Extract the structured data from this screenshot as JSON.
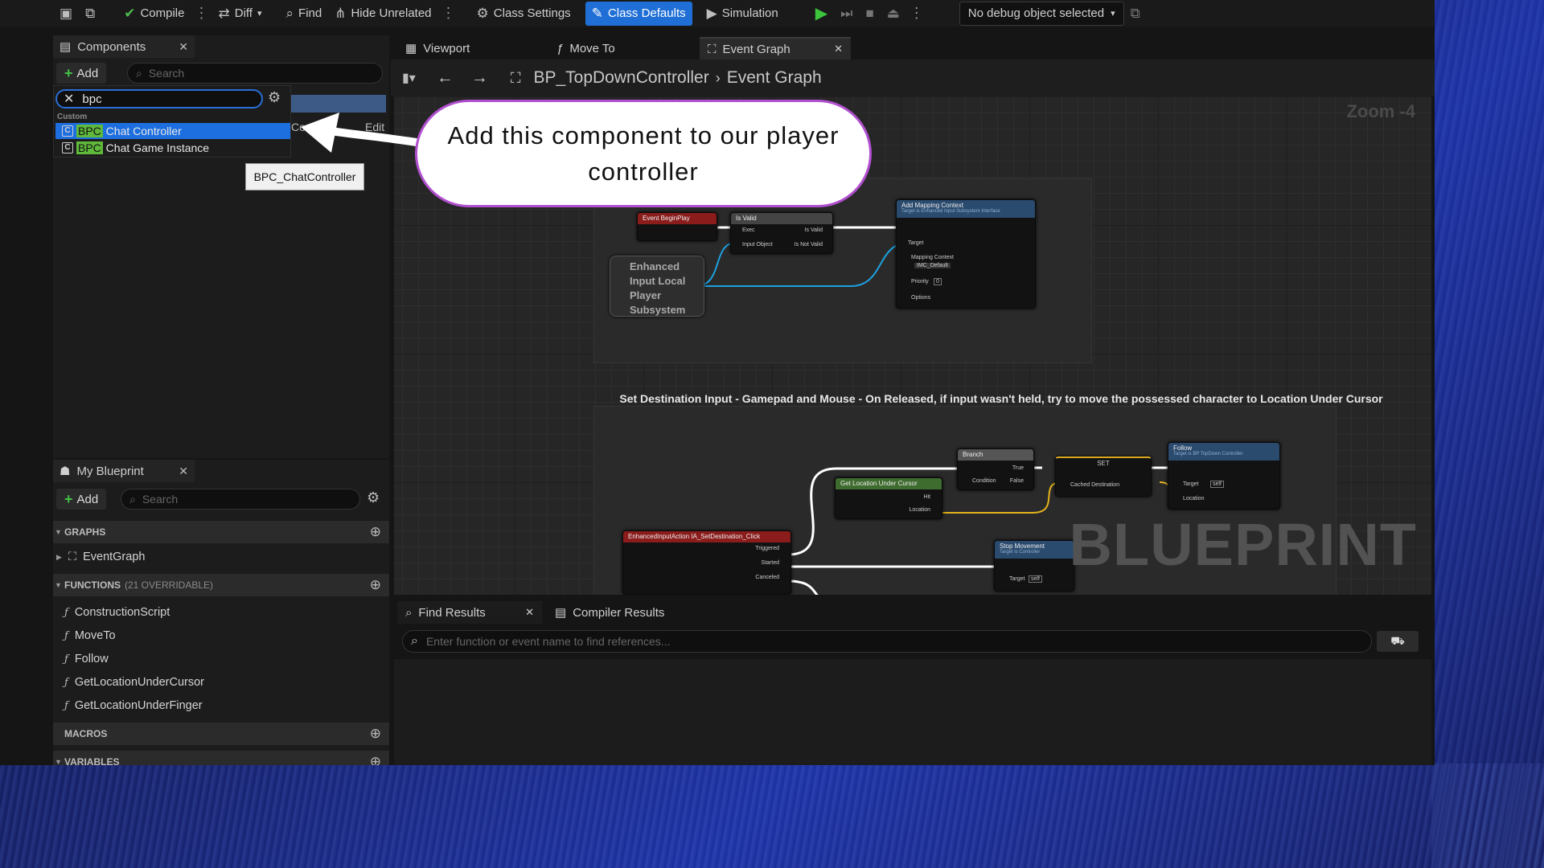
{
  "toolbar": {
    "compile": "Compile",
    "diff": "Diff",
    "find": "Find",
    "hide_unrelated": "Hide Unrelated",
    "class_settings": "Class Settings",
    "class_defaults": "Class Defaults",
    "simulation": "Simulation",
    "debug_object": "No debug object selected"
  },
  "components": {
    "tab_title": "Components",
    "add_label": "Add",
    "search_placeholder": "Search",
    "dropdown": {
      "query": "bpc",
      "category": "Custom",
      "items": [
        {
          "highlight": "BPC",
          "rest": " Chat Controller"
        },
        {
          "highlight": "BPC",
          "rest": " Chat Game Instance"
        }
      ],
      "partial_behind": "Co",
      "edit_label": "Edit"
    },
    "tooltip": "BPC_ChatController"
  },
  "my_blueprint": {
    "tab_title": "My Blueprint",
    "add_label": "Add",
    "search_placeholder": "Search",
    "sections": {
      "graphs": "GRAPHS",
      "functions": "FUNCTIONS",
      "functions_count": "(21 OVERRIDABLE)",
      "macros": "MACROS",
      "variables": "VARIABLES"
    },
    "graphs": [
      "EventGraph"
    ],
    "functions": [
      "ConstructionScript",
      "MoveTo",
      "Follow",
      "GetLocationUnderCursor",
      "GetLocationUnderFinger"
    ]
  },
  "graph_tabs": [
    "Viewport",
    "Move To",
    "Event Graph"
  ],
  "breadcrumb": {
    "root": "BP_TopDownController",
    "current": "Event Graph"
  },
  "graph": {
    "zoom": "Zoom -4",
    "watermark": "BLUEPRINT",
    "comment_title": "Set Destination Input - Gamepad and Mouse - On Released, if input wasn't held, try to move the possessed character to Location Under Cursor",
    "nodes": {
      "begin_play": "Event BeginPlay",
      "is_valid": "Is Valid",
      "is_valid_exec": "Exec",
      "is_valid_input": "Input Object",
      "is_valid_true": "Is Valid",
      "is_valid_false": "Is Not Valid",
      "subsystem": "Enhanced Input Local Player Subsystem",
      "add_mapping": "Add Mapping Context",
      "add_mapping_sub": "Target is Enhanced Input Subsystem Interface",
      "target": "Target",
      "mapping_context": "Mapping Context",
      "mapping_value": "IMC_Default",
      "priority": "Priority",
      "priority_value": "0",
      "options": "Options",
      "ia_click": "EnhancedInputAction IA_SetDestination_Click",
      "triggered": "Triggered",
      "started": "Started",
      "canceled": "Canceled",
      "get_location": "Get Location Under Cursor",
      "hit": "Hit",
      "location": "Location",
      "branch": "Branch",
      "condition": "Condition",
      "true": "True",
      "false": "False",
      "set": "SET",
      "cached_destination": "Cached Destination",
      "follow": "Follow",
      "follow_sub": "Target is BP TopDown Controller",
      "self": "self",
      "stop_movement": "Stop Movement",
      "stop_sub": "Target is Controller"
    }
  },
  "bottom": {
    "find_results": "Find Results",
    "compiler_results": "Compiler Results",
    "find_placeholder": "Enter function or event name to find references..."
  },
  "callout": "Add this component to our player controller"
}
